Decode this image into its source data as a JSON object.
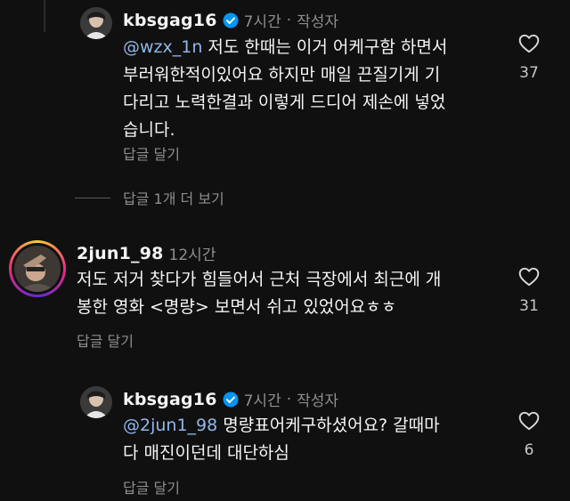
{
  "comments": [
    {
      "username": "kbsgag16",
      "time": "7시간",
      "separator": "·",
      "author_tag": "작성자",
      "mention": "@wzx_1n",
      "text": " 저도 한때는 이거 어케구함 하면서\n부러워한적이있어요 하지만 매일 끈질기게 기\n다리고 노력한결과 이렇게 드디어 제손에 넣었\n습니다.",
      "reply_label": "답글 달기",
      "likes": "37",
      "more_replies": "답글 1개 더 보기"
    },
    {
      "username": "2jun1_98",
      "time": "12시간",
      "text": "저도 저거 찾다가 힘들어서 근처 극장에서 최근에 개\n봉한 영화 <명량> 보면서 쉬고 있었어요ㅎㅎ",
      "reply_label": "답글 달기",
      "likes": "31"
    },
    {
      "username": "kbsgag16",
      "time": "7시간",
      "separator": "·",
      "author_tag": "작성자",
      "mention": "@2jun1_98",
      "text": " 명량표어케구하셨어요? 갈때마\n다 매진이던데 대단하심",
      "reply_label": "답글 달기",
      "likes": "6"
    }
  ],
  "colors": {
    "background": "#101010",
    "mention": "#8fb7e8",
    "verified": "#0095f6",
    "muted": "#8e8e8e"
  },
  "icons": [
    "verified-badge-icon",
    "heart-outline-icon"
  ]
}
